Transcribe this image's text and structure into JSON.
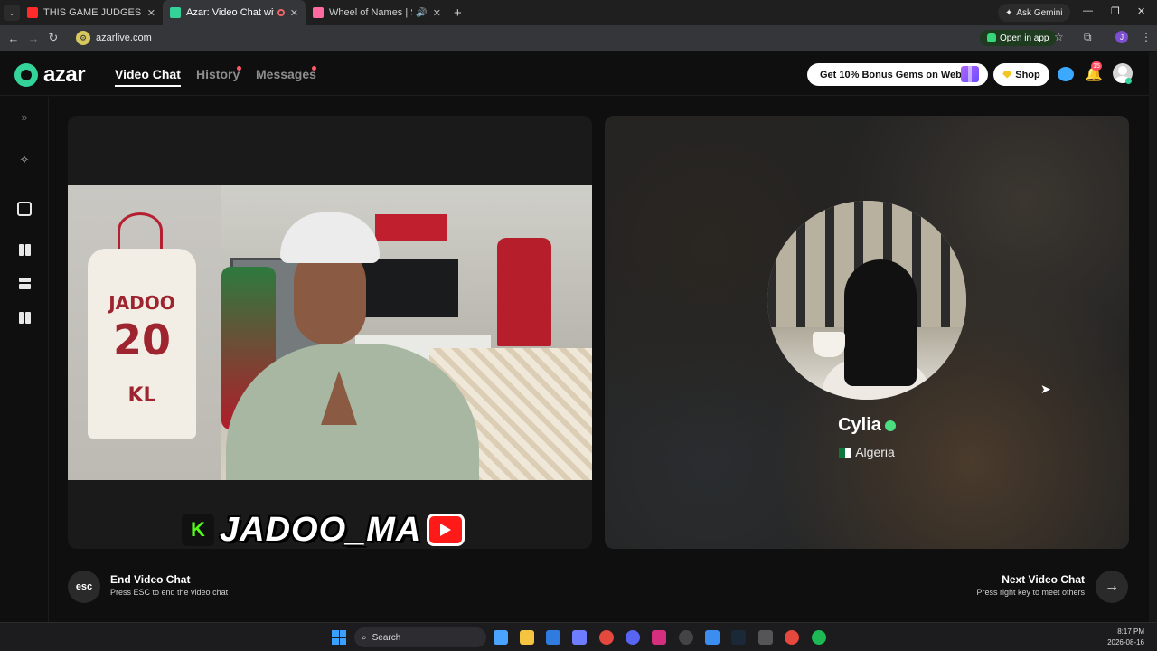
{
  "browser": {
    "tabs": [
      {
        "title": "THIS GAME JUDGES YOUR VOICE",
        "active": false,
        "favicon_color": "#ff2a2a"
      },
      {
        "title": "Azar: Video Chat with New",
        "active": true,
        "favicon_color": "#34d399"
      },
      {
        "title": "Wheel of Names | Sélecteur",
        "active": false,
        "favicon_color": "#ff6aa0"
      }
    ],
    "ask_gemini": "Ask Gemini",
    "url": "azarlive.com",
    "open_in_app": "Open in app",
    "profile_initial": "J"
  },
  "app": {
    "logo_text": "azar",
    "nav": {
      "video_chat": "Video Chat",
      "history": "History",
      "messages": "Messages"
    },
    "bonus_label": "Get 10% Bonus Gems on Web!",
    "shop_label": "Shop",
    "notification_count": "15"
  },
  "self_view": {
    "jersey_name": "JADOO",
    "jersey_number": "20",
    "jersey_initials": "KL",
    "streamer_handle": "JADOO_MA",
    "kick_letter": "K"
  },
  "peer": {
    "name": "Cylia",
    "country": "Algeria"
  },
  "controls": {
    "esc_key": "esc",
    "end_title": "End Video Chat",
    "end_subtitle": "Press ESC to end the video chat",
    "next_title": "Next Video Chat",
    "next_subtitle": "Press right key to meet others"
  },
  "taskbar": {
    "search_label": "Search",
    "time": "8:17 PM",
    "date": "2026-08-16"
  },
  "colors": {
    "brand": "#34d399",
    "background": "#0f0f0f",
    "alert": "#ff4d5f"
  }
}
